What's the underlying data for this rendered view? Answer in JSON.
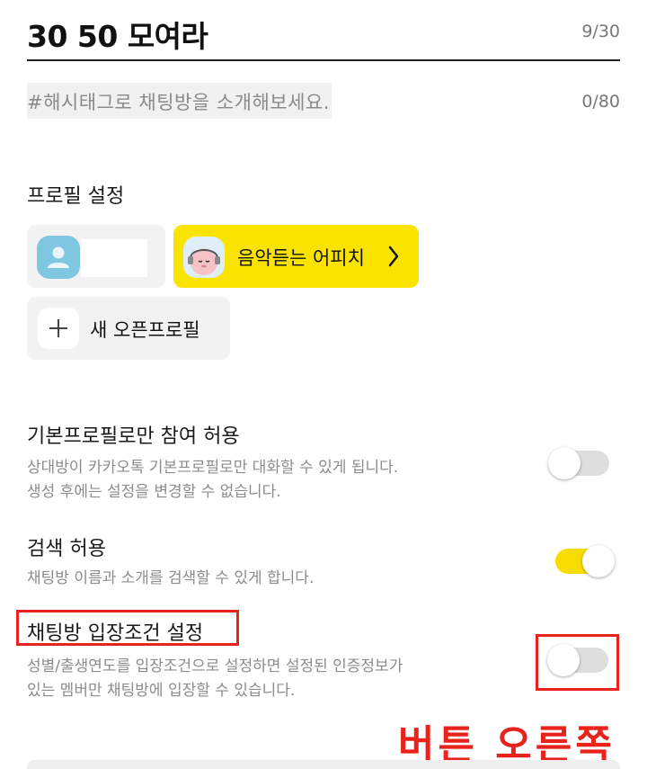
{
  "chat_room": {
    "title_value": "30 50 모여라",
    "title_count": "9/30",
    "hashtag_placeholder": "#해시태그로 채팅방을 소개해보세요.",
    "hashtag_count": "0/80"
  },
  "profile_settings": {
    "section_title": "프로필 설정",
    "open_profile_label": "음악듣는 어피치",
    "new_profile_label": "새 오픈프로필",
    "open_profile_color": "#fbe300"
  },
  "settings": [
    {
      "title": "기본프로필로만 참여 허용",
      "desc_line1": "상대방이 카카오톡 기본프로필로만 대화할 수 있게 됩니다.",
      "desc_line2": "생성 후에는 설정을 변경할 수 없습니다.",
      "toggle_on": false
    },
    {
      "title": "검색 허용",
      "desc_line1": "채팅방 이름과 소개를 검색할 수 있게 합니다.",
      "toggle_on": true
    },
    {
      "title": "채팅방 입장조건 설정",
      "desc_line1": "성별/출생연도를 입장조건으로 설정하면 설정된 인증정보가",
      "desc_line2": "있는 멤버만 채팅방에 입장할 수 있습니다.",
      "toggle_on": false
    }
  ],
  "annotation": {
    "text": "버튼 오른쪽",
    "color": "#e8231b"
  },
  "icons": {
    "default_avatar": "person-icon",
    "open_profile_avatar": "apeach-character-icon",
    "chevron": "chevron-right-icon",
    "plus": "plus-icon"
  },
  "toggle_on_color": "#f6dc00"
}
